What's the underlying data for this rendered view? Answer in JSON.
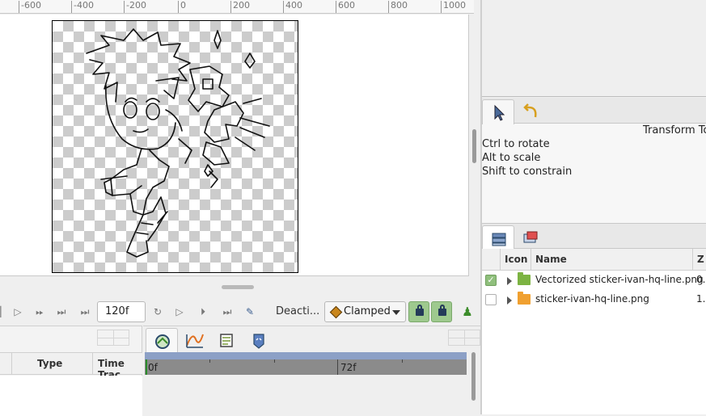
{
  "ruler": {
    "labels": [
      "-600",
      "-400",
      "-200",
      "0",
      "200",
      "400",
      "600",
      "800",
      "1000"
    ]
  },
  "playback": {
    "frame_value": "120f",
    "deactivate_label": "Deacti...",
    "interpolation_value": "Clamped"
  },
  "params_panel": {
    "columns": [
      "Type",
      "Time Trac"
    ]
  },
  "timeline": {
    "labels": [
      "0f",
      "72f"
    ]
  },
  "tool_options": {
    "title": "Transform Too",
    "hints": [
      "Ctrl to rotate",
      "Alt to scale",
      "Shift to constrain"
    ]
  },
  "layers": {
    "columns": {
      "icon": "Icon",
      "name": "Name",
      "z": "Z"
    },
    "rows": [
      {
        "name": "Vectorized sticker-ivan-hq-line.png",
        "z": "0.",
        "visible": true,
        "folder_color": "#7cb342"
      },
      {
        "name": "sticker-ivan-hq-line.png",
        "z": "1.",
        "visible": false,
        "folder_color": "#f0a030"
      }
    ]
  },
  "colors": {
    "accent_green": "#9ec98e",
    "timeline_blue": "#8ca0c6",
    "interp_diamond": "#c9861c"
  }
}
